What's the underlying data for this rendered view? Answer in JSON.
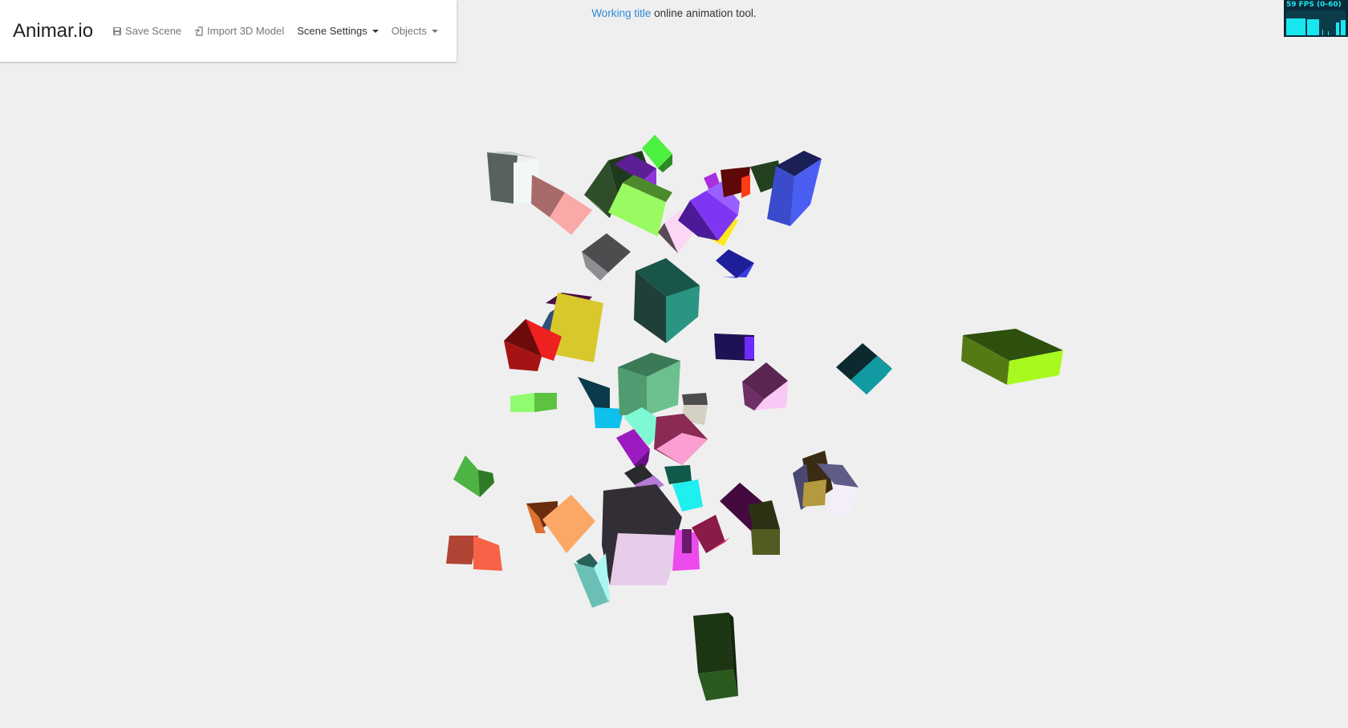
{
  "navbar": {
    "brand": "Animar.io",
    "items": [
      {
        "label": "Save Scene",
        "icon": "save-icon"
      },
      {
        "label": "Import 3D Model",
        "icon": "import-icon"
      },
      {
        "label": "Scene Settings",
        "icon": "chevron-down-icon"
      },
      {
        "label": "Objects",
        "icon": "chevron-down-icon"
      }
    ]
  },
  "banner": {
    "link_text": "Working title",
    "rest_text": " online animation tool."
  },
  "stats": {
    "fps_text": "59 FPS (0-60)",
    "fps": 59,
    "fps_min": 0,
    "fps_max": 60,
    "graph_color": "#19e7f0",
    "background_color": "#0b2a39"
  },
  "scene": {
    "background_color": "#efefef",
    "object_type": "box",
    "object_colors": [
      "#f2f7f7",
      "#fba8a8",
      "#4cf03e",
      "#8d35d9",
      "#2f4d2a",
      "#9afa61",
      "#ff3b16",
      "#4a5ef2",
      "#7f36f2",
      "#fcd7f5",
      "#ffe81a",
      "#4d4d50",
      "#3c3ae6",
      "#2a9583",
      "#d8c82c",
      "#ef2020",
      "#1f1156",
      "#8ffb6f",
      "#6cc08e",
      "#0fc0ec",
      "#a7f91f",
      "#129aa3",
      "#fbc8f6",
      "#7ef9d4",
      "#fb9fd3",
      "#9c1bc0",
      "#d4d0c4",
      "#1fefef",
      "#fba866",
      "#9a48b9",
      "#ec4aed",
      "#ec3a7a",
      "#e6cdea",
      "#aaf6f2",
      "#f86246",
      "#4db342",
      "#545b22",
      "#b49a3f",
      "#f3eefa",
      "#1c3513"
    ]
  }
}
